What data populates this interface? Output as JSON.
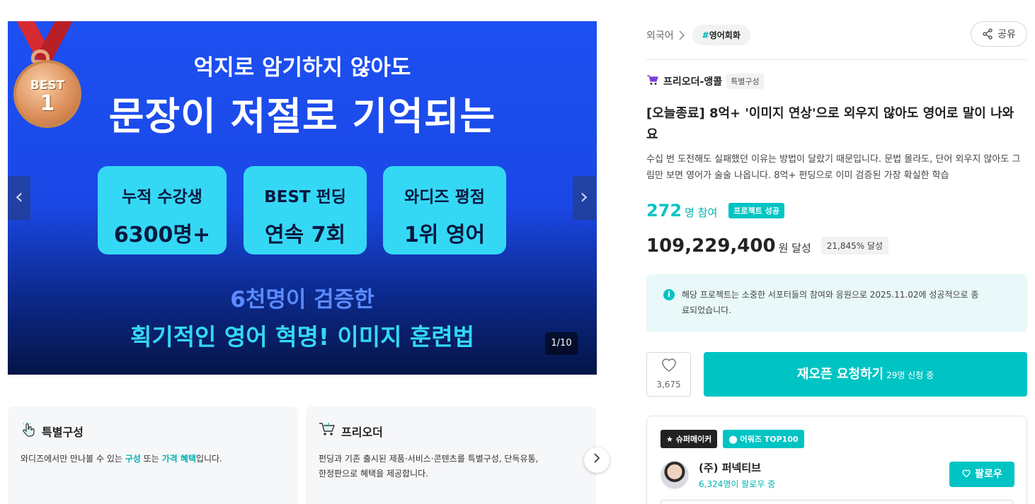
{
  "hero": {
    "badge_top": "BEST",
    "badge_num": "1",
    "subtitle": "억지로 암기하지 않아도",
    "title": "문장이 저절로 기억되는",
    "stats": [
      {
        "label": "누적 수강생",
        "value": "6300명+"
      },
      {
        "label": "BEST 펀딩",
        "value": "연속 7회"
      },
      {
        "label": "와디즈 평점",
        "value": "1위 영어"
      }
    ],
    "line1": "6천명이 검증한",
    "line2": "획기적인 영어 혁명! 이미지 훈련법",
    "counter": "1/10",
    "prev_glyph": "‹",
    "next_glyph": "›"
  },
  "features": [
    {
      "title": "특별구성",
      "desc_before": "와디즈에서만 만나볼 수 있는 ",
      "hl1": "구성",
      "desc_mid": " 또는 ",
      "hl2": "가격 혜택",
      "desc_after": "입니다."
    },
    {
      "title": "프리오더",
      "desc_line1": "펀딩과 기존 출시된 제품·서비스·콘텐츠를 특별구성, 단독유통,",
      "desc_line2": "한정판으로 혜택을 제공합니다."
    }
  ],
  "breadcrumb": {
    "category": "외국어",
    "tag_hash": "#",
    "tag": "영어회화"
  },
  "share": {
    "label": "공유"
  },
  "maker_row": {
    "name": "프리오더-앵콜",
    "tag": "특별구성"
  },
  "project": {
    "title": "[오늘종료] 8억+ '이미지 연상'으로 외우지 않아도 영어로 말이 나와요",
    "description": "수십 번 도전해도 실패했던 이유는 방법이 달랐기 때문입니다. 문법 몰라도, 단어 외우지 않아도 그림만 보면 영어가 술술 나옵니다. 8억+ 펀딩으로 이미 검증된 가장 확실한 학습"
  },
  "participants": {
    "count": "272",
    "unit": "명 참여",
    "badge": "프로젝트 성공"
  },
  "amount": {
    "value": "109,229,400",
    "unit": "원 달성",
    "rate": "21,845% 달성"
  },
  "notice": {
    "icon": "i",
    "text": "해당 프로젝트는 소중한 서포터들의 참여와 응원으로 2025.11.02에 성공적으로 종료되었습니다."
  },
  "like": {
    "count": "3,675"
  },
  "reopen": {
    "label": "재오픈 요청하기",
    "sub": "29명 신청 중"
  },
  "maker_card": {
    "badge1": "슈퍼메이커",
    "badge2": "어워즈 TOP100",
    "name": "(주) 퍼넥티브",
    "followers": "6,324명이 팔로우 중",
    "follow_label": "팔로우"
  },
  "colors": {
    "accent": "#00c4c4",
    "hero_blue": "#1d50f2",
    "stat_cyan": "#34d8f5"
  }
}
